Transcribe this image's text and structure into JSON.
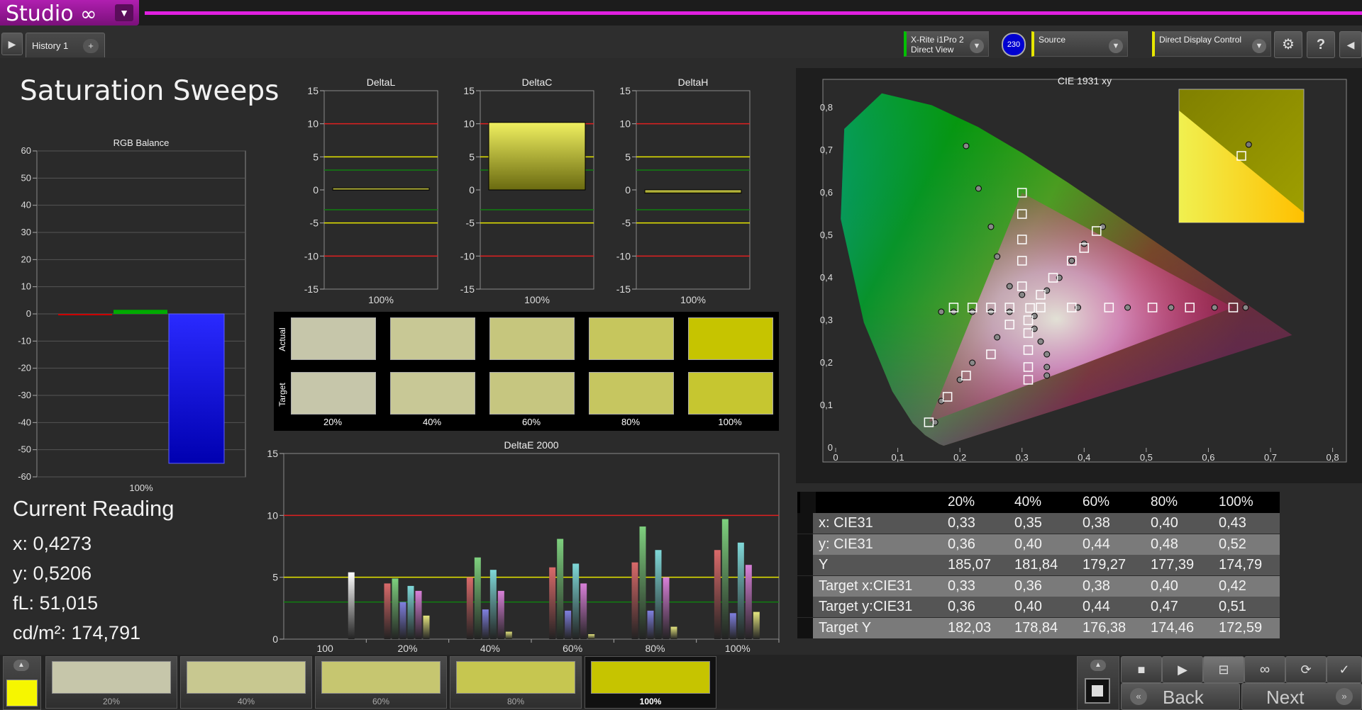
{
  "app": {
    "logo": "Studio",
    "logo_symbol": "∞"
  },
  "toolbar": {
    "history_tab": "History 1",
    "add_tab": "+",
    "probe_line1": "X-Rite i1Pro 2",
    "probe_line2": "Direct View",
    "probe_badge": "230",
    "source_label": "Source",
    "display_label": "Direct Display Control"
  },
  "page_title": "Saturation Sweeps",
  "current_reading": {
    "heading": "Current Reading",
    "x": "x: 0,4273",
    "y": "y: 0,5206",
    "fl": "fL: 51,015",
    "cdm2": "cd/m²: 174,791"
  },
  "rgb_balance": {
    "title": "RGB Balance",
    "xlabel": "100%",
    "ticks": [
      "60",
      "50",
      "40",
      "30",
      "20",
      "10",
      "0",
      "-10",
      "-20",
      "-30",
      "-40",
      "-50",
      "-60"
    ],
    "values": {
      "r": -0.3,
      "g": 1.5,
      "b": -55
    }
  },
  "delta_charts": [
    {
      "title": "DeltaL",
      "xlabel": "100%",
      "value": 0.3
    },
    {
      "title": "DeltaC",
      "xlabel": "100%",
      "value": 10.2
    },
    {
      "title": "DeltaH",
      "xlabel": "100%",
      "value": -0.5
    }
  ],
  "delta_ticks": [
    "15",
    "10",
    "5",
    "0",
    "-5",
    "-10",
    "-15"
  ],
  "swatches": {
    "actual_label": "Actual",
    "target_label": "Target",
    "labels": [
      "20%",
      "40%",
      "60%",
      "80%",
      "100%"
    ],
    "actual_colors": [
      "#c6c6aa",
      "#c8c895",
      "#c6c67d",
      "#c6c65d",
      "#c6c400"
    ],
    "target_colors": [
      "#c6c6aa",
      "#c8c896",
      "#c6c680",
      "#c6c660",
      "#c6c630"
    ]
  },
  "deltae": {
    "title": "DeltaE 2000",
    "ticks": [
      "15",
      "10",
      "5",
      "0"
    ],
    "categories": [
      "100",
      "20%",
      "40%",
      "60%",
      "80%",
      "100%"
    ]
  },
  "chart_data": [
    {
      "type": "bar",
      "title": "DeltaE 2000",
      "ylim": [
        0,
        15
      ],
      "categories": [
        "100",
        "20%",
        "40%",
        "60%",
        "80%",
        "100%"
      ],
      "series": [
        {
          "color": "#ffffff",
          "values": [
            5.4,
            null,
            null,
            null,
            null,
            null
          ]
        },
        {
          "color": "#d96a6a",
          "values": [
            null,
            4.5,
            5.0,
            5.8,
            6.2,
            7.2
          ]
        },
        {
          "color": "#7ed07e",
          "values": [
            null,
            4.9,
            6.6,
            8.1,
            9.1,
            9.7
          ]
        },
        {
          "color": "#8080e0",
          "values": [
            null,
            3.0,
            2.4,
            2.3,
            2.3,
            2.1
          ]
        },
        {
          "color": "#7fd8d8",
          "values": [
            null,
            4.3,
            5.6,
            6.1,
            7.2,
            7.8
          ]
        },
        {
          "color": "#d880d8",
          "values": [
            null,
            3.9,
            3.9,
            4.5,
            5.0,
            6.0
          ]
        },
        {
          "color": "#e6e680",
          "values": [
            null,
            1.9,
            0.6,
            0.4,
            1.0,
            2.2
          ]
        }
      ]
    },
    {
      "type": "scatter",
      "title": "CIE 1931 xy",
      "xlim": [
        0,
        0.8
      ],
      "ylim": [
        0,
        0.85
      ],
      "xticks": [
        "0",
        "0,1",
        "0,2",
        "0,3",
        "0,4",
        "0,5",
        "0,6",
        "0,7",
        "0,8"
      ],
      "yticks": [
        "0",
        "0,1",
        "0,2",
        "0,3",
        "0,4",
        "0,5",
        "0,6",
        "0,7",
        "0,8"
      ],
      "gamut": [
        [
          0.64,
          0.33
        ],
        [
          0.3,
          0.6
        ],
        [
          0.15,
          0.06
        ]
      ],
      "targets": [
        [
          0.313,
          0.329
        ],
        [
          0.33,
          0.33
        ],
        [
          0.38,
          0.33
        ],
        [
          0.44,
          0.33
        ],
        [
          0.51,
          0.33
        ],
        [
          0.57,
          0.33
        ],
        [
          0.64,
          0.33
        ],
        [
          0.3,
          0.6
        ],
        [
          0.3,
          0.55
        ],
        [
          0.3,
          0.49
        ],
        [
          0.3,
          0.44
        ],
        [
          0.3,
          0.38
        ],
        [
          0.28,
          0.33
        ],
        [
          0.25,
          0.33
        ],
        [
          0.22,
          0.33
        ],
        [
          0.19,
          0.33
        ],
        [
          0.28,
          0.29
        ],
        [
          0.25,
          0.22
        ],
        [
          0.21,
          0.17
        ],
        [
          0.18,
          0.12
        ],
        [
          0.15,
          0.06
        ],
        [
          0.31,
          0.3
        ],
        [
          0.31,
          0.27
        ],
        [
          0.31,
          0.23
        ],
        [
          0.31,
          0.19
        ],
        [
          0.31,
          0.16
        ],
        [
          0.33,
          0.36
        ],
        [
          0.35,
          0.4
        ],
        [
          0.38,
          0.44
        ],
        [
          0.4,
          0.47
        ],
        [
          0.42,
          0.51
        ]
      ],
      "actuals": [
        [
          0.21,
          0.71
        ],
        [
          0.23,
          0.61
        ],
        [
          0.25,
          0.52
        ],
        [
          0.26,
          0.45
        ],
        [
          0.28,
          0.38
        ],
        [
          0.3,
          0.36
        ],
        [
          0.17,
          0.32
        ],
        [
          0.19,
          0.32
        ],
        [
          0.22,
          0.32
        ],
        [
          0.25,
          0.32
        ],
        [
          0.28,
          0.32
        ],
        [
          0.66,
          0.33
        ],
        [
          0.61,
          0.33
        ],
        [
          0.54,
          0.33
        ],
        [
          0.47,
          0.33
        ],
        [
          0.39,
          0.33
        ],
        [
          0.26,
          0.26
        ],
        [
          0.22,
          0.2
        ],
        [
          0.2,
          0.16
        ],
        [
          0.17,
          0.11
        ],
        [
          0.16,
          0.06
        ],
        [
          0.32,
          0.28
        ],
        [
          0.33,
          0.25
        ],
        [
          0.34,
          0.22
        ],
        [
          0.34,
          0.19
        ],
        [
          0.34,
          0.17
        ],
        [
          0.34,
          0.37
        ],
        [
          0.36,
          0.4
        ],
        [
          0.38,
          0.44
        ],
        [
          0.4,
          0.48
        ],
        [
          0.43,
          0.52
        ],
        [
          0.32,
          0.31
        ]
      ],
      "inset_actual": [
        0.4273,
        0.5206
      ],
      "inset_target": [
        0.42,
        0.51
      ]
    }
  ],
  "table": {
    "headers": [
      "20%",
      "40%",
      "60%",
      "80%",
      "100%"
    ],
    "rows": [
      {
        "label": "x: CIE31",
        "values": [
          "0,33",
          "0,35",
          "0,38",
          "0,40",
          "0,43"
        ]
      },
      {
        "label": "y: CIE31",
        "values": [
          "0,36",
          "0,40",
          "0,44",
          "0,48",
          "0,52"
        ]
      },
      {
        "label": "Y",
        "values": [
          "185,07",
          "181,84",
          "179,27",
          "177,39",
          "174,79"
        ]
      },
      {
        "label": "Target x:CIE31",
        "values": [
          "0,33",
          "0,36",
          "0,38",
          "0,40",
          "0,42"
        ]
      },
      {
        "label": "Target y:CIE31",
        "values": [
          "0,36",
          "0,40",
          "0,44",
          "0,47",
          "0,51"
        ]
      },
      {
        "label": "Target Y",
        "values": [
          "182,03",
          "178,84",
          "176,38",
          "174,46",
          "172,59"
        ]
      }
    ]
  },
  "bottom": {
    "current_color": "#f6f600",
    "steps": [
      {
        "label": "20%",
        "color": "#c6c6aa"
      },
      {
        "label": "40%",
        "color": "#c8c890"
      },
      {
        "label": "60%",
        "color": "#c6c670"
      },
      {
        "label": "80%",
        "color": "#c6c650"
      },
      {
        "label": "100%",
        "color": "#c6c400"
      }
    ],
    "back_label": "Back",
    "next_label": "Next"
  }
}
